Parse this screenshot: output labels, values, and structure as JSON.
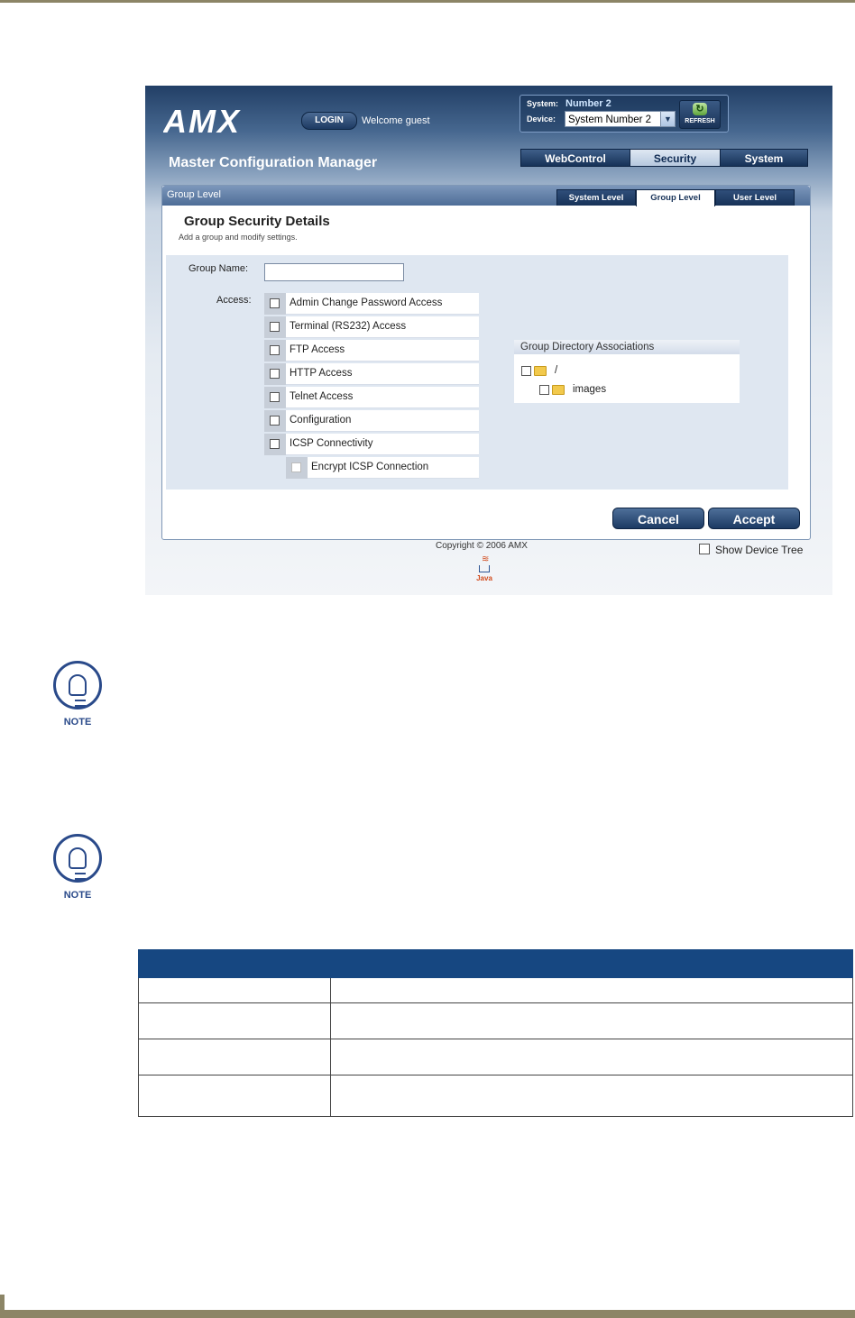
{
  "app": {
    "brand": "AMX",
    "login_label": "LOGIN",
    "welcome": "Welcome guest",
    "title": "Master Configuration Manager",
    "system_label": "System:",
    "system_value": "Number 2",
    "device_label": "Device:",
    "device_value": "System Number 2",
    "refresh_label": "REFRESH"
  },
  "main_tabs": [
    {
      "label": "WebControl"
    },
    {
      "label": "Security",
      "active": true
    },
    {
      "label": "System"
    }
  ],
  "panel": {
    "title": "Group Level",
    "sub_tabs": [
      {
        "label": "System Level"
      },
      {
        "label": "Group Level",
        "active": true
      },
      {
        "label": "User Level"
      }
    ],
    "heading": "Group Security Details",
    "subheading": "Add a group and modify settings."
  },
  "form": {
    "group_name_label": "Group Name:",
    "group_name_value": "",
    "access_label": "Access:",
    "access_items": [
      {
        "label": "Admin Change Password Access",
        "checked": false
      },
      {
        "label": "Terminal (RS232) Access",
        "checked": false
      },
      {
        "label": "FTP Access",
        "checked": false
      },
      {
        "label": "HTTP Access",
        "checked": false
      },
      {
        "label": "Telnet Access",
        "checked": false
      },
      {
        "label": "Configuration",
        "checked": false
      },
      {
        "label": "ICSP Connectivity",
        "checked": false
      },
      {
        "label": "Encrypt ICSP Connection",
        "checked": false,
        "disabled": true
      }
    ],
    "directory": {
      "title": "Group Directory Associations",
      "items": [
        {
          "label": "/"
        },
        {
          "label": "images"
        }
      ]
    }
  },
  "buttons": {
    "cancel": "Cancel",
    "accept": "Accept"
  },
  "footer": {
    "copyright": "Copyright © 2006 AMX",
    "java": "Java",
    "show_device_tree": "Show Device Tree"
  },
  "notes": [
    {
      "label": "NOTE"
    },
    {
      "label": "NOTE"
    }
  ],
  "colors": {
    "page_rule": "#8c8566",
    "table_header": "#164781",
    "note_blue": "#2a4a8a"
  }
}
